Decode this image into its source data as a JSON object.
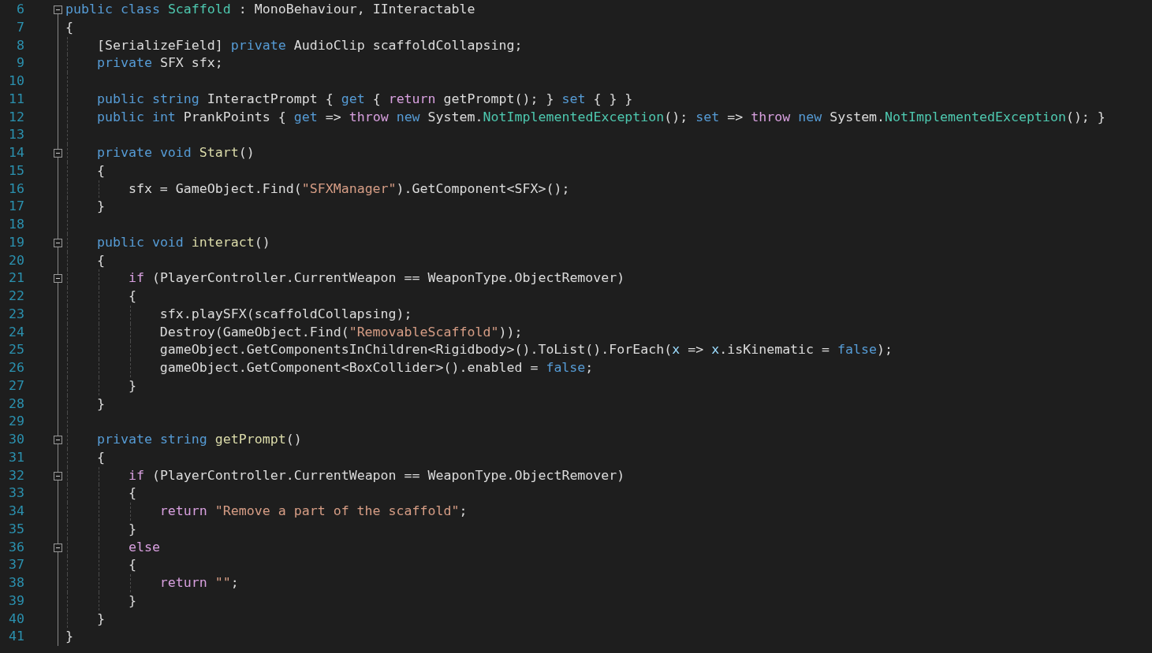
{
  "editor": {
    "lines": [
      {
        "number": "6",
        "fold": {
          "expanded": true
        },
        "tokens": [
          {
            "kind": "kw",
            "text": "public class "
          },
          {
            "kind": "type",
            "text": "Scaffold"
          },
          {
            "kind": "plain",
            "text": " : MonoBehaviour, IInteractable"
          }
        ]
      },
      {
        "number": "7",
        "tokens": [
          {
            "kind": "plain",
            "text": "{"
          }
        ]
      },
      {
        "number": "8",
        "tokens": [
          {
            "kind": "plain",
            "text": "    [SerializeField] "
          },
          {
            "kind": "kw",
            "text": "private "
          },
          {
            "kind": "plain",
            "text": "AudioClip scaffoldCollapsing;"
          }
        ]
      },
      {
        "number": "9",
        "tokens": [
          {
            "kind": "kw",
            "text": "    private "
          },
          {
            "kind": "plain",
            "text": "SFX sfx;"
          }
        ]
      },
      {
        "number": "10"
      },
      {
        "number": "11",
        "tokens": [
          {
            "kind": "kw",
            "text": "    public string "
          },
          {
            "kind": "plain",
            "text": "InteractPrompt { "
          },
          {
            "kind": "kw",
            "text": "get"
          },
          {
            "kind": "plain",
            "text": " { "
          },
          {
            "kind": "ctl",
            "text": "return "
          },
          {
            "kind": "plain",
            "text": "getPrompt(); } "
          },
          {
            "kind": "kw",
            "text": "set"
          },
          {
            "kind": "plain",
            "text": " { } }"
          }
        ]
      },
      {
        "number": "12",
        "tokens": [
          {
            "kind": "kw",
            "text": "    public int "
          },
          {
            "kind": "plain",
            "text": "PrankPoints { "
          },
          {
            "kind": "kw",
            "text": "get"
          },
          {
            "kind": "plain",
            "text": " => "
          },
          {
            "kind": "ctl",
            "text": "throw "
          },
          {
            "kind": "kw",
            "text": "new "
          },
          {
            "kind": "plain",
            "text": "System."
          },
          {
            "kind": "type",
            "text": "NotImplementedException"
          },
          {
            "kind": "plain",
            "text": "(); "
          },
          {
            "kind": "kw",
            "text": "set"
          },
          {
            "kind": "plain",
            "text": " => "
          },
          {
            "kind": "ctl",
            "text": "throw "
          },
          {
            "kind": "kw",
            "text": "new "
          },
          {
            "kind": "plain",
            "text": "System."
          },
          {
            "kind": "type",
            "text": "NotImplementedException"
          },
          {
            "kind": "plain",
            "text": "(); }"
          }
        ]
      },
      {
        "number": "13"
      },
      {
        "number": "14",
        "fold": {
          "expanded": true
        },
        "tokens": [
          {
            "kind": "kw",
            "text": "    private void "
          },
          {
            "kind": "method",
            "text": "Start"
          },
          {
            "kind": "plain",
            "text": "()"
          }
        ]
      },
      {
        "number": "15",
        "tokens": [
          {
            "kind": "plain",
            "text": "    {"
          }
        ]
      },
      {
        "number": "16",
        "tokens": [
          {
            "kind": "plain",
            "text": "        sfx = GameObject.Find("
          },
          {
            "kind": "str",
            "text": "\"SFXManager\""
          },
          {
            "kind": "plain",
            "text": ").GetComponent<SFX>();"
          }
        ]
      },
      {
        "number": "17",
        "tokens": [
          {
            "kind": "plain",
            "text": "    }"
          }
        ]
      },
      {
        "number": "18"
      },
      {
        "number": "19",
        "fold": {
          "expanded": true
        },
        "tokens": [
          {
            "kind": "kw",
            "text": "    public void "
          },
          {
            "kind": "method",
            "text": "interact"
          },
          {
            "kind": "plain",
            "text": "()"
          }
        ]
      },
      {
        "number": "20",
        "tokens": [
          {
            "kind": "plain",
            "text": "    {"
          }
        ]
      },
      {
        "number": "21",
        "fold": {
          "expanded": true
        },
        "tokens": [
          {
            "kind": "ctl",
            "text": "        if "
          },
          {
            "kind": "plain",
            "text": "(PlayerController.CurrentWeapon == WeaponType.ObjectRemover)"
          }
        ]
      },
      {
        "number": "22",
        "tokens": [
          {
            "kind": "plain",
            "text": "        {"
          }
        ]
      },
      {
        "number": "23",
        "tokens": [
          {
            "kind": "plain",
            "text": "            sfx.playSFX(scaffoldCollapsing);"
          }
        ]
      },
      {
        "number": "24",
        "tokens": [
          {
            "kind": "plain",
            "text": "            Destroy(GameObject.Find("
          },
          {
            "kind": "str",
            "text": "\"RemovableScaffold\""
          },
          {
            "kind": "plain",
            "text": "));"
          }
        ]
      },
      {
        "number": "25",
        "tokens": [
          {
            "kind": "plain",
            "text": "            gameObject.GetComponentsInChildren<Rigidbody>().ToList().ForEach("
          },
          {
            "kind": "param",
            "text": "x"
          },
          {
            "kind": "plain",
            "text": " => "
          },
          {
            "kind": "param",
            "text": "x"
          },
          {
            "kind": "plain",
            "text": ".isKinematic = "
          },
          {
            "kind": "kw",
            "text": "false"
          },
          {
            "kind": "plain",
            "text": ");"
          }
        ]
      },
      {
        "number": "26",
        "tokens": [
          {
            "kind": "plain",
            "text": "            gameObject.GetComponent<BoxCollider>().enabled = "
          },
          {
            "kind": "kw",
            "text": "false"
          },
          {
            "kind": "plain",
            "text": ";"
          }
        ]
      },
      {
        "number": "27",
        "tokens": [
          {
            "kind": "plain",
            "text": "        }"
          }
        ]
      },
      {
        "number": "28",
        "tokens": [
          {
            "kind": "plain",
            "text": "    }"
          }
        ]
      },
      {
        "number": "29"
      },
      {
        "number": "30",
        "fold": {
          "expanded": true
        },
        "tokens": [
          {
            "kind": "kw",
            "text": "    private string "
          },
          {
            "kind": "method",
            "text": "getPrompt"
          },
          {
            "kind": "plain",
            "text": "()"
          }
        ]
      },
      {
        "number": "31",
        "tokens": [
          {
            "kind": "plain",
            "text": "    {"
          }
        ]
      },
      {
        "number": "32",
        "fold": {
          "expanded": true
        },
        "tokens": [
          {
            "kind": "ctl",
            "text": "        if "
          },
          {
            "kind": "plain",
            "text": "(PlayerController.CurrentWeapon == WeaponType.ObjectRemover)"
          }
        ]
      },
      {
        "number": "33",
        "tokens": [
          {
            "kind": "plain",
            "text": "        {"
          }
        ]
      },
      {
        "number": "34",
        "tokens": [
          {
            "kind": "ctl",
            "text": "            return "
          },
          {
            "kind": "str",
            "text": "\"Remove a part of the scaffold\""
          },
          {
            "kind": "plain",
            "text": ";"
          }
        ]
      },
      {
        "number": "35",
        "tokens": [
          {
            "kind": "plain",
            "text": "        }"
          }
        ]
      },
      {
        "number": "36",
        "fold": {
          "expanded": true
        },
        "tokens": [
          {
            "kind": "ctl",
            "text": "        else"
          }
        ]
      },
      {
        "number": "37",
        "tokens": [
          {
            "kind": "plain",
            "text": "        {"
          }
        ]
      },
      {
        "number": "38",
        "tokens": [
          {
            "kind": "ctl",
            "text": "            return "
          },
          {
            "kind": "str",
            "text": "\"\""
          },
          {
            "kind": "plain",
            "text": ";"
          }
        ]
      },
      {
        "number": "39",
        "tokens": [
          {
            "kind": "plain",
            "text": "        }"
          }
        ]
      },
      {
        "number": "40",
        "tokens": [
          {
            "kind": "plain",
            "text": "    }"
          }
        ]
      },
      {
        "number": "41",
        "tokens": [
          {
            "kind": "plain",
            "text": "}"
          }
        ]
      }
    ]
  }
}
